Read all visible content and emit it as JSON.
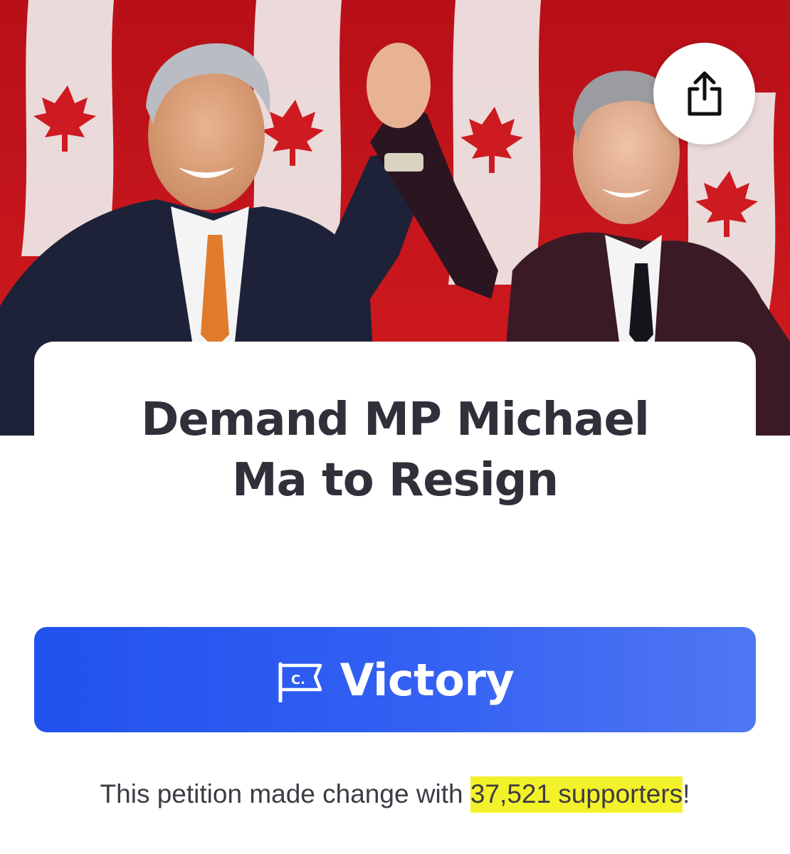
{
  "hero": {
    "photo": "two-men-raised-hands-canadian-flags",
    "share_icon": "share-upload-icon"
  },
  "petition": {
    "title_line1": "Demand MP Michael",
    "title_line2": "Ma to Resign"
  },
  "status_button": {
    "icon": "change-org-flag-icon",
    "icon_text": "C.",
    "label": "Victory",
    "color": "#2f5cf2"
  },
  "footer": {
    "prefix": "This petition made change with ",
    "supporters_count": "37,521",
    "supporters_word": " supporters",
    "suffix": "!",
    "highlight_color": "#f3f22a"
  }
}
